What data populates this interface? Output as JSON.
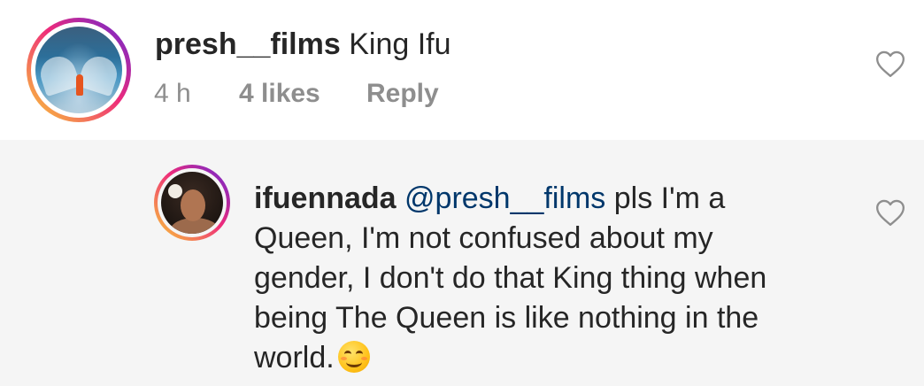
{
  "top_comment": {
    "username": "presh__films",
    "text": "King Ifu",
    "time": "4 h",
    "likes": "4 likes",
    "reply_label": "Reply"
  },
  "reply_comment": {
    "username": "ifuennada",
    "mention": "@presh__films",
    "text_before_emoji": "pls I'm a Queen, I'm not confused about my gender, I don't do that King thing when being The Queen is like nothing in the world.",
    "emoji": "smiling-face-icon"
  },
  "icons": {
    "like": "heart-outline-icon"
  },
  "colors": {
    "text": "#262626",
    "meta": "#8e8e8e",
    "mention": "#00376b",
    "reply_background": "#f5f5f5"
  }
}
